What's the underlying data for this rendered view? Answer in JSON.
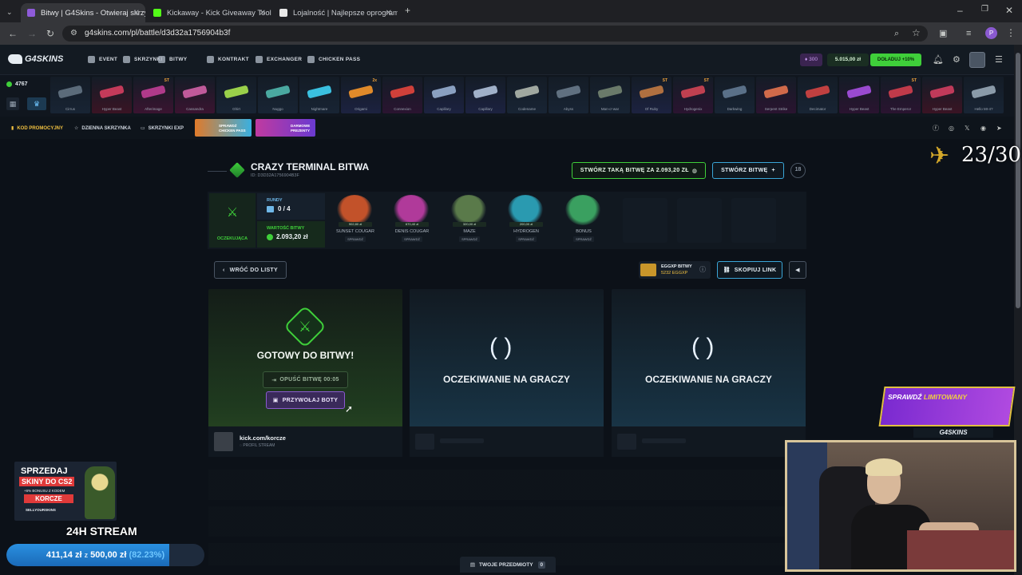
{
  "browser": {
    "tabs": [
      {
        "title": "Bitwy | G4Skins - Otwieraj skrzy",
        "fav": "#8e5bd9"
      },
      {
        "title": "Kickaway - Kick Giveaway Tool",
        "fav": "#53fc18"
      },
      {
        "title": "Lojalność | Najlepsze oprogram",
        "fav": "#e8e8e8"
      }
    ],
    "url": "g4skins.com/pl/battle/d3d32a1756904b3f",
    "profile_initial": "P"
  },
  "header": {
    "logo": "G4SKINS",
    "nav": [
      "EVENT",
      "SKRZYNKI",
      "BITWY",
      "KONTRAKT",
      "EXCHANGER",
      "CHICKEN PASS"
    ],
    "points": "300",
    "balance": "5.015,00 zł",
    "topup": "DOŁADUJ +10%"
  },
  "strip": {
    "count": "4767",
    "skins": [
      {
        "name": "Cirrus",
        "st": "",
        "bg": "#182434",
        "gun": "#5b6b7a"
      },
      {
        "name": "Hyper Beast",
        "st": "",
        "bg": "#3a1424",
        "gun": "#c43a5a"
      },
      {
        "name": "Afterimage",
        "st": "ST",
        "bg": "#3a1430",
        "gun": "#b03a8a"
      },
      {
        "name": "Cassandra",
        "st": "",
        "bg": "#3a1430",
        "gun": "#c05a9a"
      },
      {
        "name": "Ghirt",
        "st": "",
        "bg": "#182434",
        "gun": "#9ad04a"
      },
      {
        "name": "Nuggo",
        "st": "",
        "bg": "#182434",
        "gun": "#4aa8a0"
      },
      {
        "name": "Nightmare",
        "st": "",
        "bg": "#182434",
        "gun": "#3ac0e0"
      },
      {
        "name": "Origami",
        "st": "2x",
        "bg": "#1c2240",
        "gun": "#e08a2a"
      },
      {
        "name": "Connexion",
        "st": "",
        "bg": "#2a1430",
        "gun": "#d0403a"
      },
      {
        "name": "Capillary",
        "st": "",
        "bg": "#1c2240",
        "gun": "#8aa0c0"
      },
      {
        "name": "Capillary",
        "st": "",
        "bg": "#1c2240",
        "gun": "#a0b0c8"
      },
      {
        "name": "Codename",
        "st": "",
        "bg": "#182434",
        "gun": "#a0a8a0"
      },
      {
        "name": "Abyss",
        "st": "",
        "bg": "#182434",
        "gun": "#607080"
      },
      {
        "name": "Man-o'-war",
        "st": "",
        "bg": "#182434",
        "gun": "#6a7a6a"
      },
      {
        "name": "Of Ruby",
        "st": "ST",
        "bg": "#1c2240",
        "gun": "#b07040"
      },
      {
        "name": "Hydrogenix",
        "st": "ST",
        "bg": "#2a1430",
        "gun": "#c04050"
      },
      {
        "name": "Darkwing",
        "st": "",
        "bg": "#182434",
        "gun": "#5a7088"
      },
      {
        "name": "Serpent Strike",
        "st": "",
        "bg": "#2a1430",
        "gun": "#d06a4a"
      },
      {
        "name": "Decimator",
        "st": "",
        "bg": "#182434",
        "gun": "#c04040"
      },
      {
        "name": "Hyper Beast",
        "st": "",
        "bg": "#2a1430",
        "gun": "#9a4ad0"
      },
      {
        "name": "The Emperor",
        "st": "ST",
        "bg": "#2a1430",
        "gun": "#c03a4a"
      },
      {
        "name": "Hyper Beast",
        "st": "",
        "bg": "#3a1424",
        "gun": "#c03a5a"
      },
      {
        "name": "Hello MI-4?",
        "st": "",
        "bg": "#182434",
        "gun": "#8a9aa8"
      }
    ]
  },
  "promo": {
    "code": "KOD PROMOCYJNY",
    "daily": "DZIENNA SKRZYNKA",
    "exp": "SKRZYNKI EXP",
    "banner1_a": "SPRAWDŹ",
    "banner1_b": "CHICKEN PASS",
    "banner2_a": "DARMOWE",
    "banner2_b": "PREZENTY"
  },
  "battle": {
    "title": "CRAZY TERMINAL BITWA",
    "id": "ID: D3D32A1756904B3F",
    "create_same": "STWÓRZ TAKĄ BITWĘ ZA 2.093,20 ZŁ",
    "create": "STWÓRZ BITWĘ",
    "age": "18",
    "status": "OCZEKUJĄCA",
    "rounds_label": "RUNDY",
    "rounds_value": "0 / 4",
    "value_label": "WARTOŚĆ BITWY",
    "value": "2.093,20 zł",
    "cases": [
      {
        "name": "SUNSET COUGAR",
        "price": "902,80 zł",
        "color": "#c2522a"
      },
      {
        "name": "DENIS COUGAR",
        "price": "670,40 zł",
        "color": "#b03a9a"
      },
      {
        "name": "MAZE",
        "price": "320,00 zł",
        "color": "#5a7a4a"
      },
      {
        "name": "HYDROGEN",
        "price": "200,00 zł",
        "color": "#2a9ab0"
      },
      {
        "name": "BONUS",
        "price": "",
        "color": "#3aa060"
      }
    ],
    "check": "SPRAWDŹ",
    "back": "WRÓĆ DO LISTY",
    "eggxp_label": "EGGXP BITWY",
    "eggxp_value": "5232 EGGXP",
    "copy_link": "SKOPIUJ LINK",
    "ready": "GOTOWY DO BITWY!",
    "leave": "OPUŚĆ BITWĘ 00:05",
    "call_bots": "PRZYWOŁAJ BOTY",
    "waiting": "OCZEKIWANIE NA GRACZY",
    "player_name": "kick.com/korcze",
    "player_sub": "PROFIL STREAM",
    "my_items": "TWOJE PRZEDMIOTY",
    "my_items_count": "0"
  },
  "overlay": {
    "counter": "23/30",
    "limited_a": "SPRAWDŹ",
    "limited_b": "LIMITOWANY",
    "limited_logo": "G4SKINS",
    "promo_line1": "SPRZEDAJ",
    "promo_line2": "SKINY DO CS2",
    "promo_line3": "+6% BONUSU Z KODEM",
    "promo_code": "KORCZE",
    "promo_brand": "SELLYOURSKINS",
    "stream_label": "24H STREAM",
    "progress_current": "411,14 zł",
    "progress_sep": "z",
    "progress_goal": "500,00 zł",
    "progress_pct": "(82.23%)",
    "progress_fraction": 0.8223
  }
}
